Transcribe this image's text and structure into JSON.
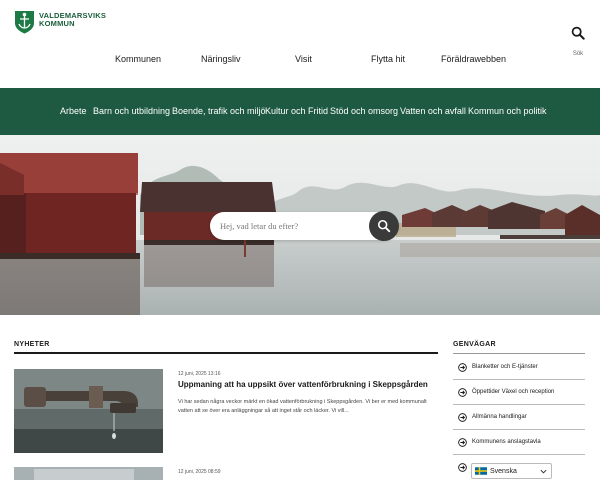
{
  "header": {
    "logo_line1": "VALDEMARSVIKS",
    "logo_line2": "KOMMUN",
    "search_label": "Sök",
    "icon_search": "search-icon",
    "brand_color": "#1e5a42"
  },
  "top_nav": [
    "Kommunen",
    "Näringsliv",
    "Visit",
    "Flytta hit",
    "Föräldrawebben"
  ],
  "green_nav": [
    "Arbete",
    "Barn och utbildning",
    "Boende, trafik och miljö",
    "Kultur och Fritid",
    "Stöd och omsorg",
    "Vatten och avfall",
    "Kommun och politik"
  ],
  "hero": {
    "search_placeholder": "Hej, vad letar du efter?",
    "icon_search": "search-icon"
  },
  "news": {
    "heading": "NYHETER",
    "items": [
      {
        "date": "12 juni, 2025 13:16",
        "title": "Uppmaning att ha uppsikt över vattenförbrukning i Skeppsgården",
        "excerpt": "Vi har sedan några veckor märkt en ökad vattenförbrukning i Skeppsgården. Vi ber er med kommunalt vatten att se över era anläggningar så att inget står och läcker. Vi vill..."
      },
      {
        "date": "12 juni, 2025 08:59",
        "title": "",
        "excerpt": ""
      }
    ]
  },
  "shortcuts": {
    "heading": "GENVÄGAR",
    "icon": "arrow-circle-right-icon",
    "items": [
      "Blanketter och E-tjänster",
      "Öppettider Växel och reception",
      "Allmänna handlingar",
      "Kommunens anslagstavla",
      ""
    ]
  },
  "language": {
    "selected": "Svenska",
    "icon_flag": "swedish-flag-icon",
    "icon_chevron": "chevron-down-icon"
  }
}
